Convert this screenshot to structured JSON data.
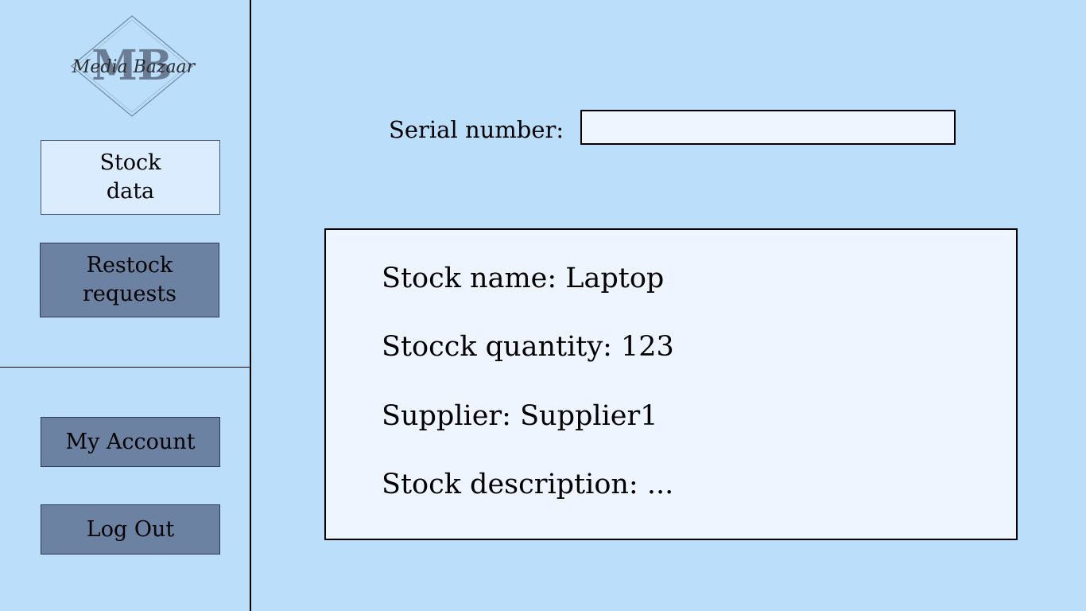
{
  "logo": {
    "monogram": "MB",
    "script_text": "Media Bazaar"
  },
  "sidebar": {
    "stock_data_label": "Stock\ndata",
    "restock_label": "Restock\nrequests",
    "account_label": "My Account",
    "logout_label": "Log Out"
  },
  "search": {
    "label": "Serial number:",
    "value": "",
    "placeholder": ""
  },
  "stock": {
    "name_line": "Stock name: Laptop",
    "quantity_line": "Stocck quantity: 123",
    "supplier_line": "Supplier: Supplier1",
    "description_line": "Stock description: ..."
  },
  "colors": {
    "background": "#bbdefb",
    "active_button": "#dbecfe",
    "dark_button": "#6b82a2",
    "panel": "#eef5fe"
  }
}
